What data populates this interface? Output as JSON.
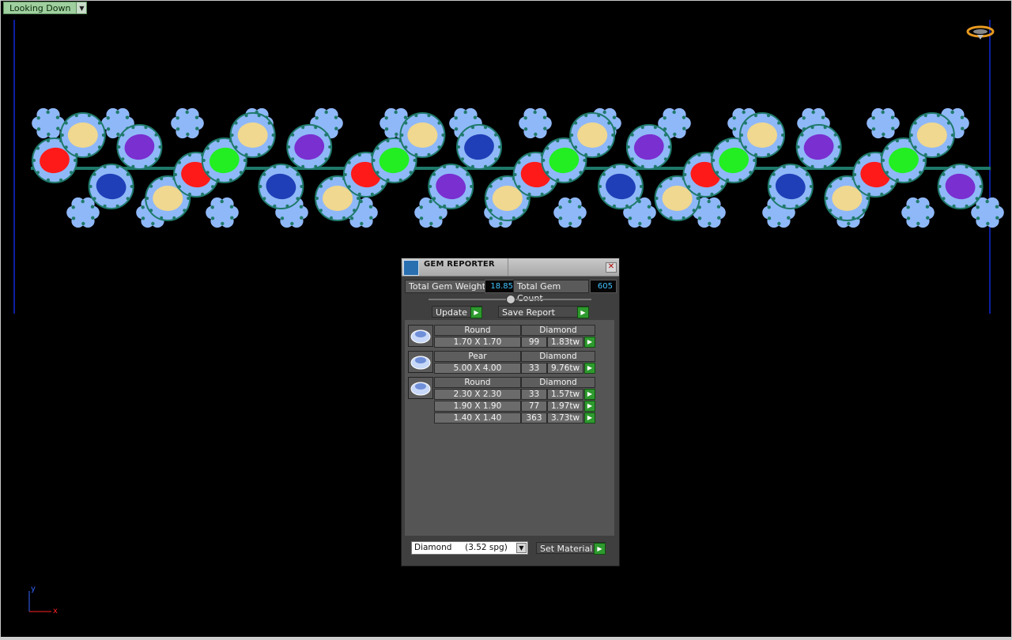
{
  "view": {
    "label": "Looking Down"
  },
  "axes": {
    "y": "y",
    "x": "x"
  },
  "panel": {
    "title": "GEM REPORTER",
    "total_weight_label": "Total Gem Weight",
    "total_weight_value": "18.85",
    "total_count_label": "Total Gem Count",
    "total_count_value": "605",
    "update_label": "Update",
    "save_label": "Save Report",
    "groups": [
      {
        "shape": "Round",
        "material": "Diamond",
        "rows": [
          {
            "size": "1.70 X 1.70",
            "count": "99",
            "weight": "1.83tw"
          }
        ]
      },
      {
        "shape": "Pear",
        "material": "Diamond",
        "rows": [
          {
            "size": "5.00 X 4.00",
            "count": "33",
            "weight": "9.76tw"
          }
        ]
      },
      {
        "shape": "Round",
        "material": "Diamond",
        "rows": [
          {
            "size": "2.30 X 2.30",
            "count": "33",
            "weight": "1.57tw"
          },
          {
            "size": "1.90 X 1.90",
            "count": "77",
            "weight": "1.97tw"
          },
          {
            "size": "1.40 X 1.40",
            "count": "363",
            "weight": "3.73tw"
          }
        ]
      }
    ],
    "material_selected": "Diamond     (3.52 spg)",
    "set_material_label": "Set Material"
  },
  "colors": {
    "ruby": "#ff1a1a",
    "emerald": "#22ee22",
    "amethyst": "#7a2fd0",
    "sapphire": "#1f3fb8",
    "citrine": "#f0d890",
    "diamond": "#8fb8f8",
    "setting": "#1f7a6a"
  }
}
